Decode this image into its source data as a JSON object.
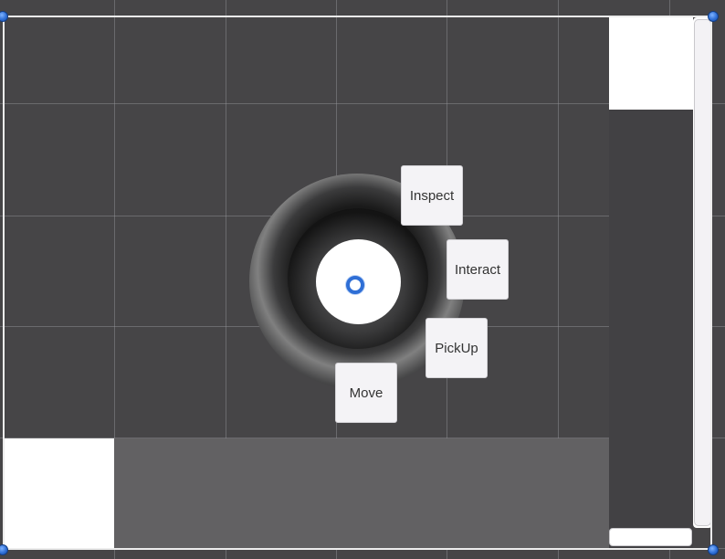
{
  "scene": {
    "background_color": "#464547",
    "selection_handle_color": "#2f6fd6"
  },
  "radial_menu": {
    "buttons": {
      "inspect": "Inspect",
      "interact": "Interact",
      "pickup": "PickUp",
      "move": "Move"
    }
  }
}
